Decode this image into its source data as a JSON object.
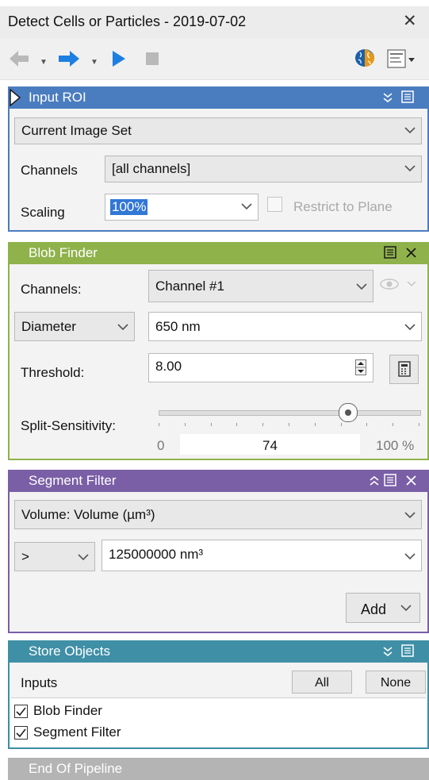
{
  "window": {
    "title": "Detect Cells or Particles - 2019-07-02",
    "close_glyph": "✕"
  },
  "toolbar": {
    "back_icon": "arrow-left-icon",
    "forward_icon": "arrow-right-icon",
    "play_icon": "play-icon",
    "stop_icon": "stop-icon",
    "brain_icon": "brain-icon",
    "menu_icon": "list-menu-icon"
  },
  "colors": {
    "input_roi": "#4a7cc0",
    "blob_finder": "#8fb24b",
    "segment_filter": "#7a5fa6",
    "store_objects": "#3f8fa6",
    "end_pipeline": "#b4b4b4",
    "play_blue": "#1d7fe0"
  },
  "input_roi": {
    "title": "Input ROI",
    "image_set": "Current Image Set",
    "channels_label": "Channels",
    "channels_value": "[all channels]",
    "scaling_label": "Scaling",
    "scaling_value": "100%",
    "restrict_label": "Restrict to Plane"
  },
  "blob_finder": {
    "title": "Blob Finder",
    "channels_label": "Channels:",
    "channel_value": "Channel #1",
    "diameter_label": "Diameter",
    "diameter_value": "650 nm",
    "threshold_label": "Threshold:",
    "threshold_value": "8.00",
    "split_label": "Split-Sensitivity:",
    "split_min": "0",
    "split_value": "74",
    "split_max": "100 %",
    "split_fraction": 0.74
  },
  "segment_filter": {
    "title": "Segment Filter",
    "feature": "Volume: Volume (µm³)",
    "operator": ">",
    "threshold": "125000000 nm³",
    "add_label": "Add"
  },
  "store_objects": {
    "title": "Store Objects",
    "inputs_label": "Inputs",
    "all_label": "All",
    "none_label": "None",
    "items": [
      {
        "label": "Blob Finder",
        "checked": true
      },
      {
        "label": "Segment Filter",
        "checked": true
      }
    ]
  },
  "end": {
    "title": "End Of Pipeline"
  }
}
